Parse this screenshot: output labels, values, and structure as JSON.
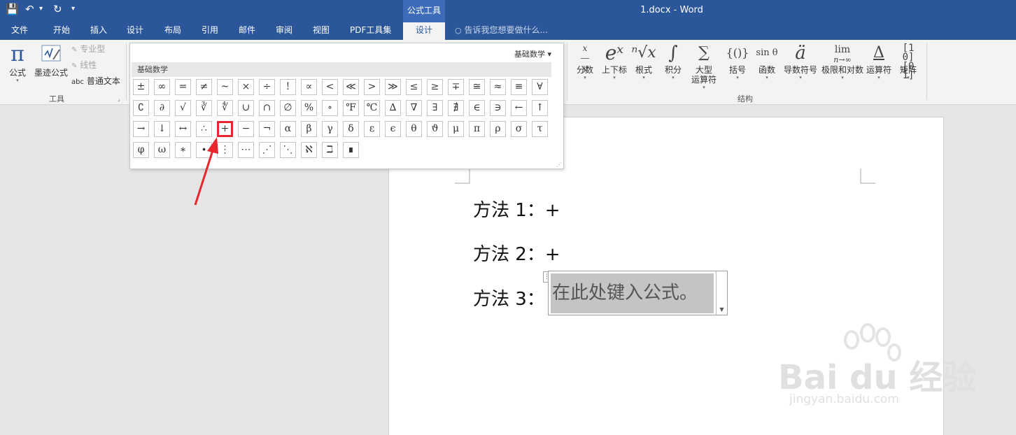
{
  "titlebar": {
    "contextual_tab": "公式工具",
    "document_title": "1.docx - Word",
    "qat": {
      "save": "💾",
      "undo": "↶",
      "undo_dd": "▾",
      "redo": "↻",
      "customize": "▾"
    }
  },
  "tabs": [
    {
      "label": "文件"
    },
    {
      "label": "开始"
    },
    {
      "label": "插入"
    },
    {
      "label": "设计"
    },
    {
      "label": "布局"
    },
    {
      "label": "引用"
    },
    {
      "label": "邮件"
    },
    {
      "label": "审阅"
    },
    {
      "label": "视图"
    },
    {
      "label": "PDF工具集"
    },
    {
      "label": "设计"
    }
  ],
  "tell_me": "告诉我您想要做什么...",
  "ribbon": {
    "tools": {
      "equation": "公式",
      "equation_icon": "π",
      "ink": "墨迹公式",
      "professional": "专业型",
      "linear": "线性",
      "normal_text_prefix": "abc",
      "normal_text": "普通文本",
      "group": "工具"
    },
    "structures": {
      "group": "结构",
      "items": [
        {
          "name": "fraction",
          "icon": "x/y",
          "label": "分数"
        },
        {
          "name": "script",
          "icon": "eˣ",
          "label": "上下标"
        },
        {
          "name": "radical",
          "icon": "ⁿ√x",
          "label": "根式"
        },
        {
          "name": "integral",
          "icon": "∫",
          "label": "积分"
        },
        {
          "name": "large-operator",
          "icon": "∑",
          "label": "大型\n运算符"
        },
        {
          "name": "bracket",
          "icon": "{()}",
          "label": "括号"
        },
        {
          "name": "function",
          "icon": "sin θ",
          "label": "函数"
        },
        {
          "name": "accent",
          "icon": "ä",
          "label": "导数符号"
        },
        {
          "name": "limit-log",
          "icon": "lim",
          "label": "极限和对数"
        },
        {
          "name": "operator",
          "icon": "Δ",
          "label": "运算符"
        },
        {
          "name": "matrix",
          "icon": "[⁰¹]",
          "label": "矩阵"
        }
      ]
    }
  },
  "gallery": {
    "dropdown_label": "基础数学 ▾",
    "section_title": "基础数学",
    "rows": [
      [
        "±",
        "∞",
        "=",
        "≠",
        "~",
        "×",
        "÷",
        "!",
        "∝",
        "<",
        "≪",
        ">",
        "≫",
        "≤",
        "≥",
        "∓",
        "≅",
        "≈",
        "≡",
        "∀"
      ],
      [
        "∁",
        "∂",
        "√",
        "∛",
        "∜",
        "∪",
        "∩",
        "∅",
        "%",
        "∘",
        "℉",
        "℃",
        "∆",
        "∇",
        "∃",
        "∄",
        "∈",
        "∋",
        "←",
        "↑"
      ],
      [
        "→",
        "↓",
        "↔",
        "∴",
        "+",
        "−",
        "¬",
        "α",
        "β",
        "γ",
        "δ",
        "ε",
        "ϵ",
        "θ",
        "ϑ",
        "μ",
        "π",
        "ρ",
        "σ",
        "τ"
      ],
      [
        "φ",
        "ω",
        "∗",
        "∙",
        "⋮",
        "⋯",
        "⋰",
        "⋱",
        "ℵ",
        "ℶ",
        "∎"
      ]
    ],
    "highlighted": "+"
  },
  "document": {
    "lines": [
      {
        "text": "方法 1：+"
      },
      {
        "text": "方法 2：+"
      },
      {
        "text": "方法 3："
      }
    ],
    "equation_placeholder": "在此处键入公式。"
  },
  "watermark": {
    "brand": "Bai du 经验",
    "url": "jingyan.baidu.com"
  },
  "colors": {
    "title_bar": "#2b579a",
    "highlight": "#e8262d"
  }
}
